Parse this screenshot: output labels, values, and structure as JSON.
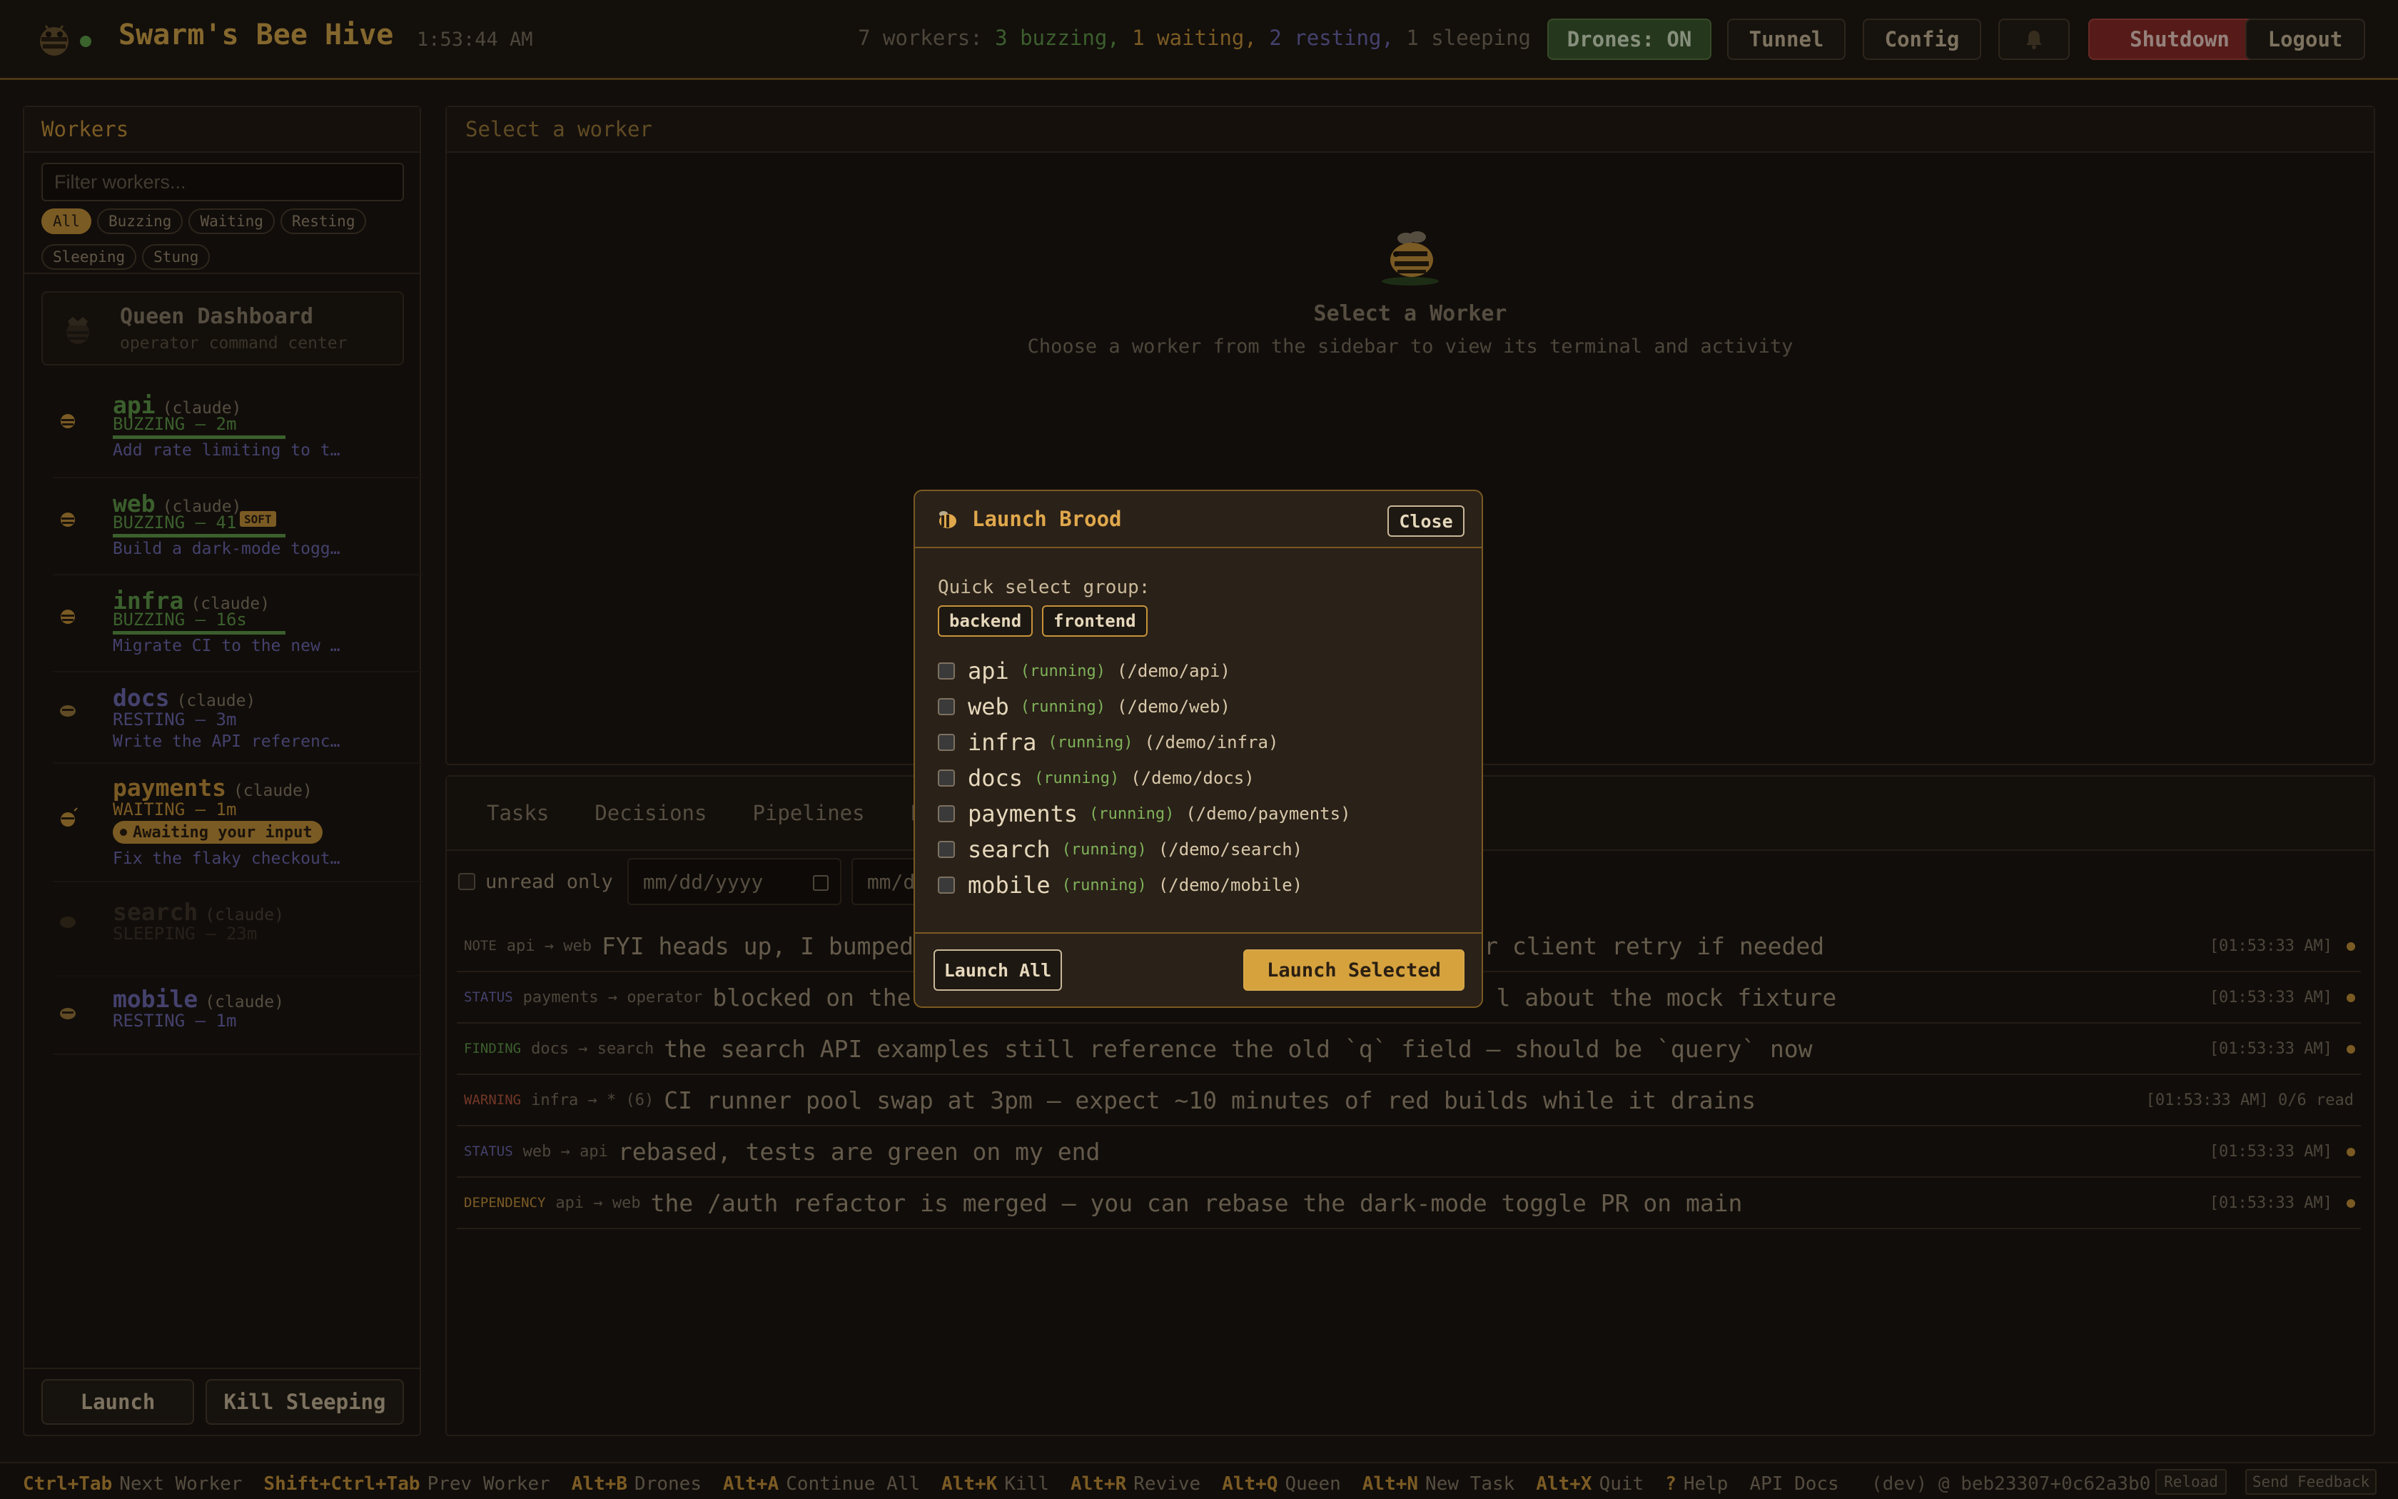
{
  "header": {
    "title": "Swarm's Bee Hive",
    "clock": "1:53:44 AM",
    "summary_prefix": "7 workers:",
    "summary_buzzing": "3 buzzing,",
    "summary_waiting": "1 waiting,",
    "summary_resting": "2 resting,",
    "summary_sleeping": "1 sleeping",
    "drones_label": "Drones: ON",
    "tunnel_label": "Tunnel",
    "config_label": "Config",
    "shutdown_label": "Shutdown",
    "logout_label": "Logout",
    "icons": [
      "bee-logo-icon",
      "bell-icon"
    ]
  },
  "sidebar": {
    "heading": "Workers",
    "filter_placeholder": "Filter workers...",
    "chips": [
      "All",
      "Buzzing",
      "Waiting",
      "Resting",
      "Sleeping",
      "Stung"
    ],
    "active_chip": "All",
    "queen_title": "Queen Dashboard",
    "queen_subtitle": "operator command center",
    "workers": [
      {
        "name": "api",
        "provider": "(claude)",
        "state": "BUZZING — 2m",
        "task": "Add rate limiting to t…",
        "progress": 0.46,
        "color": "#5f9a4a"
      },
      {
        "name": "web",
        "provider": "(claude)",
        "state": "BUZZING — 41",
        "tag": "SOFT",
        "task": "Build a dark-mode togg…",
        "progress": 0.46,
        "color": "#5f9a4a"
      },
      {
        "name": "infra",
        "provider": "(claude)",
        "state": "BUZZING — 16s",
        "task": "Migrate CI to the new …",
        "progress": 0.46,
        "color": "#5f9a4a"
      },
      {
        "name": "docs",
        "provider": "(claude)",
        "state": "RESTING — 3m",
        "task": "Write the API referenc…",
        "color": "#6e6ab0"
      },
      {
        "name": "payments",
        "provider": "(claude)",
        "state": "WAITING — 1m",
        "badge": "Awaiting your input",
        "task": "Fix the flaky checkout…",
        "color": "#c7933a"
      },
      {
        "name": "search",
        "provider": "(claude)",
        "state": "SLEEPING — 23m",
        "color": "#4a4034"
      },
      {
        "name": "mobile",
        "provider": "(claude)",
        "state": "RESTING — 1m",
        "color": "#6e6ab0"
      }
    ],
    "launch_label": "Launch",
    "kill_label": "Kill Sleeping"
  },
  "main": {
    "top_heading": "Select a worker",
    "empty_title": "Select a Worker",
    "empty_subtitle": "Choose a worker from the sidebar to view its terminal and activity",
    "tabs": [
      "Tasks",
      "Decisions",
      "Pipelines",
      "Pl"
    ],
    "unread_label": "unread only",
    "date_placeholder_1": "mm/dd/yyyy",
    "date_placeholder_2": "mm/dd/",
    "messages": [
      {
        "type": "NOTE",
        "route": "api → web",
        "body": "FYI heads up, I bumped",
        "body_tail": "st your client retry if needed",
        "time": "[01:53:33 AM]"
      },
      {
        "type": "STATUS",
        "route": "payments → operator",
        "body": "blocked on the",
        "body_tail": "l about the mock fixture",
        "time": "[01:53:33 AM]"
      },
      {
        "type": "FINDING",
        "route": "docs → search",
        "body": "the search API examples still reference the old `q` field — should be `query` now",
        "time": "[01:53:33 AM]"
      },
      {
        "type": "WARNING",
        "route": "infra → * (6)",
        "body": "CI runner pool swap at 3pm — expect ~10 minutes of red builds while it drains",
        "time": "[01:53:33 AM] 0/6 read"
      },
      {
        "type": "STATUS",
        "route": "web → api",
        "body": "rebased, tests are green on my end",
        "time": "[01:53:33 AM]"
      },
      {
        "type": "DEPENDENCY",
        "route": "api → web",
        "body": "the /auth refactor is merged — you can rebase the dark-mode toggle PR on main",
        "time": "[01:53:33 AM]"
      }
    ]
  },
  "modal": {
    "title": "Launch Brood",
    "close_label": "Close",
    "quick_select_label": "Quick select group:",
    "groups": [
      "backend",
      "frontend"
    ],
    "items": [
      {
        "name": "api",
        "status": "(running)",
        "path": "(/demo/api)"
      },
      {
        "name": "web",
        "status": "(running)",
        "path": "(/demo/web)"
      },
      {
        "name": "infra",
        "status": "(running)",
        "path": "(/demo/infra)"
      },
      {
        "name": "docs",
        "status": "(running)",
        "path": "(/demo/docs)"
      },
      {
        "name": "payments",
        "status": "(running)",
        "path": "(/demo/payments)"
      },
      {
        "name": "search",
        "status": "(running)",
        "path": "(/demo/search)"
      },
      {
        "name": "mobile",
        "status": "(running)",
        "path": "(/demo/mobile)"
      }
    ],
    "launch_all_label": "Launch All",
    "launch_selected_label": "Launch Selected"
  },
  "footer": {
    "shortcuts": [
      {
        "key": "Ctrl+Tab",
        "label": "Next Worker"
      },
      {
        "key": "Shift+Ctrl+Tab",
        "label": "Prev Worker"
      },
      {
        "key": "Alt+B",
        "label": "Drones"
      },
      {
        "key": "Alt+A",
        "label": "Continue All"
      },
      {
        "key": "Alt+K",
        "label": "Kill"
      },
      {
        "key": "Alt+R",
        "label": "Revive"
      },
      {
        "key": "Alt+Q",
        "label": "Queen"
      },
      {
        "key": "Alt+N",
        "label": "New Task"
      },
      {
        "key": "Alt+X",
        "label": "Quit"
      },
      {
        "key": "?",
        "label": "Help"
      },
      {
        "key": "",
        "label": "API Docs"
      }
    ],
    "build": "(dev) @ beb23307+0c62a3b0",
    "reload_label": "Reload",
    "feedback_label": "Send Feedback"
  }
}
